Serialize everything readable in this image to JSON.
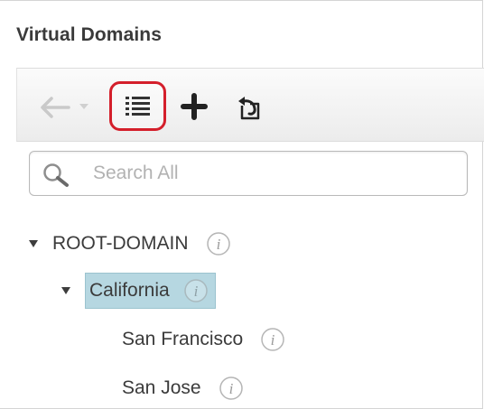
{
  "panel": {
    "title": "Virtual Domains"
  },
  "toolbar": {
    "buttons": [
      {
        "name": "back",
        "icon": "arrow-left-icon",
        "enabled": false
      },
      {
        "name": "history-dropdown",
        "icon": "caret-down-icon",
        "enabled": false
      },
      {
        "name": "list-view",
        "icon": "list-icon",
        "highlighted": true
      },
      {
        "name": "add",
        "icon": "plus-icon"
      },
      {
        "name": "import",
        "icon": "refresh-icon"
      }
    ],
    "highlight_color": "#d41f2b"
  },
  "search": {
    "placeholder": "Search All",
    "value": ""
  },
  "tree": {
    "nodes": [
      {
        "label": "ROOT-DOMAIN",
        "level": 0,
        "expanded": true,
        "selected": false
      },
      {
        "label": "California",
        "level": 1,
        "expanded": true,
        "selected": true
      },
      {
        "label": "San Francisco",
        "level": 2,
        "expanded": false,
        "selected": false
      },
      {
        "label": "San Jose",
        "level": 2,
        "expanded": false,
        "selected": false
      }
    ],
    "selected_bg": "#b6d7e1"
  }
}
